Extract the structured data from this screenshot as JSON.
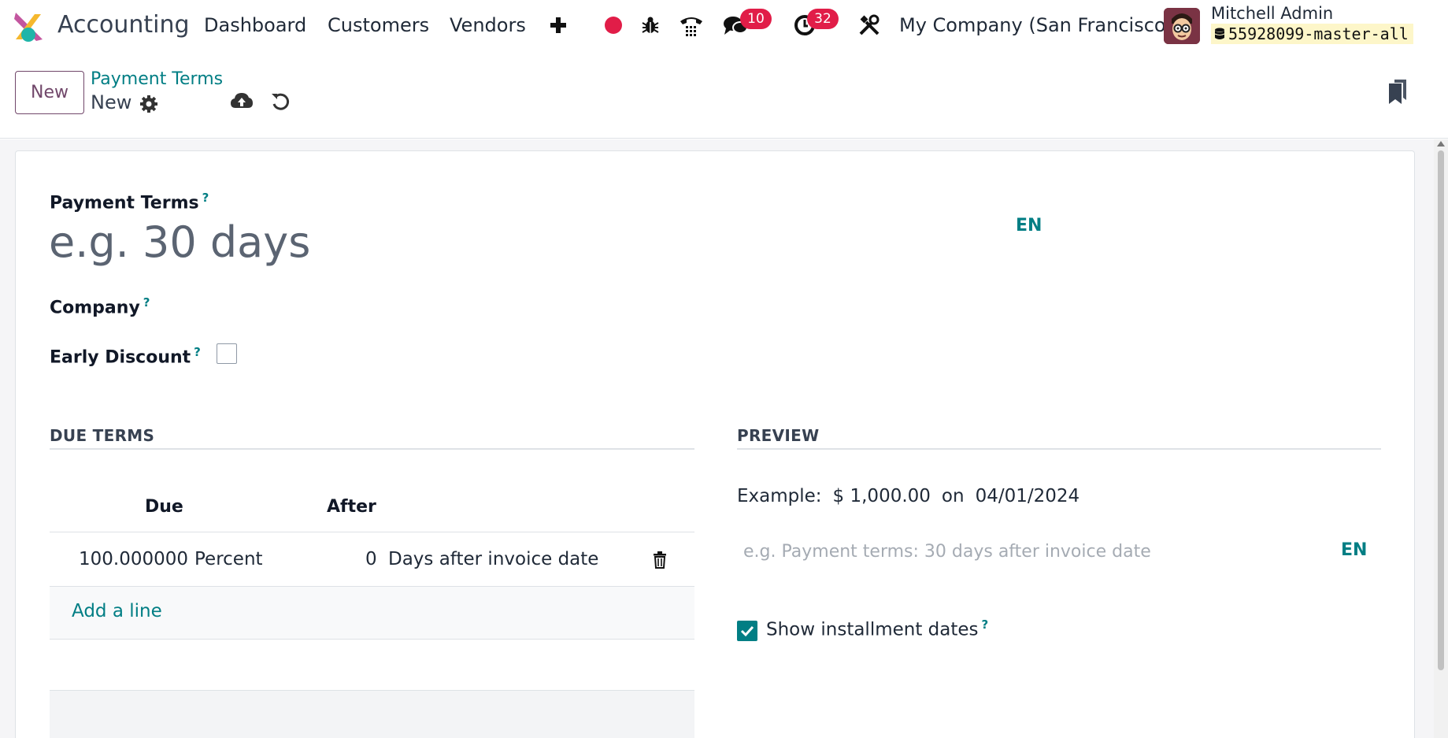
{
  "app": {
    "name": "Accounting"
  },
  "menu": [
    {
      "label": "Dashboard"
    },
    {
      "label": "Customers"
    },
    {
      "label": "Vendors"
    }
  ],
  "systray": {
    "messages_count": "10",
    "activities_count": "32",
    "company": "My Company (San Francisco)",
    "user_name": "Mitchell Admin",
    "database": "55928099-master-all",
    "record_color": "#e11d48"
  },
  "control": {
    "new_label": "New",
    "breadcrumb_parent": "Payment Terms",
    "breadcrumb_current": "New"
  },
  "form": {
    "payment_terms_label": "Payment Terms",
    "payment_terms_placeholder": "e.g. 30 days",
    "payment_terms_lang": "EN",
    "company_label": "Company",
    "early_discount_label": "Early Discount",
    "early_discount_checked": false,
    "help_mark": "?"
  },
  "due_terms": {
    "title": "DUE TERMS",
    "columns": {
      "due": "Due",
      "after": "After"
    },
    "rows": [
      {
        "due": "100.000000",
        "type": "Percent",
        "after": "0",
        "delay": "Days after invoice date"
      }
    ],
    "add_line": "Add a line"
  },
  "preview": {
    "title": "PREVIEW",
    "example_label": "Example:",
    "example_amount": "$ 1,000.00",
    "example_on": "on",
    "example_date": "04/01/2024",
    "note_placeholder": "e.g. Payment terms: 30 days after invoice date",
    "note_lang": "EN",
    "show_installments_label": "Show installment dates",
    "show_installments_checked": true
  },
  "colors": {
    "primary": "#71476a",
    "accent": "#017e84",
    "badge": "#e11d48"
  },
  "icons": [
    "plus-icon",
    "record-icon",
    "bug-icon",
    "phone-icon",
    "chat-icon",
    "clock-icon",
    "tools-icon",
    "database-icon",
    "gear-icon",
    "cloud-upload-icon",
    "undo-icon",
    "bookmark-icon",
    "trash-icon",
    "check-icon"
  ]
}
